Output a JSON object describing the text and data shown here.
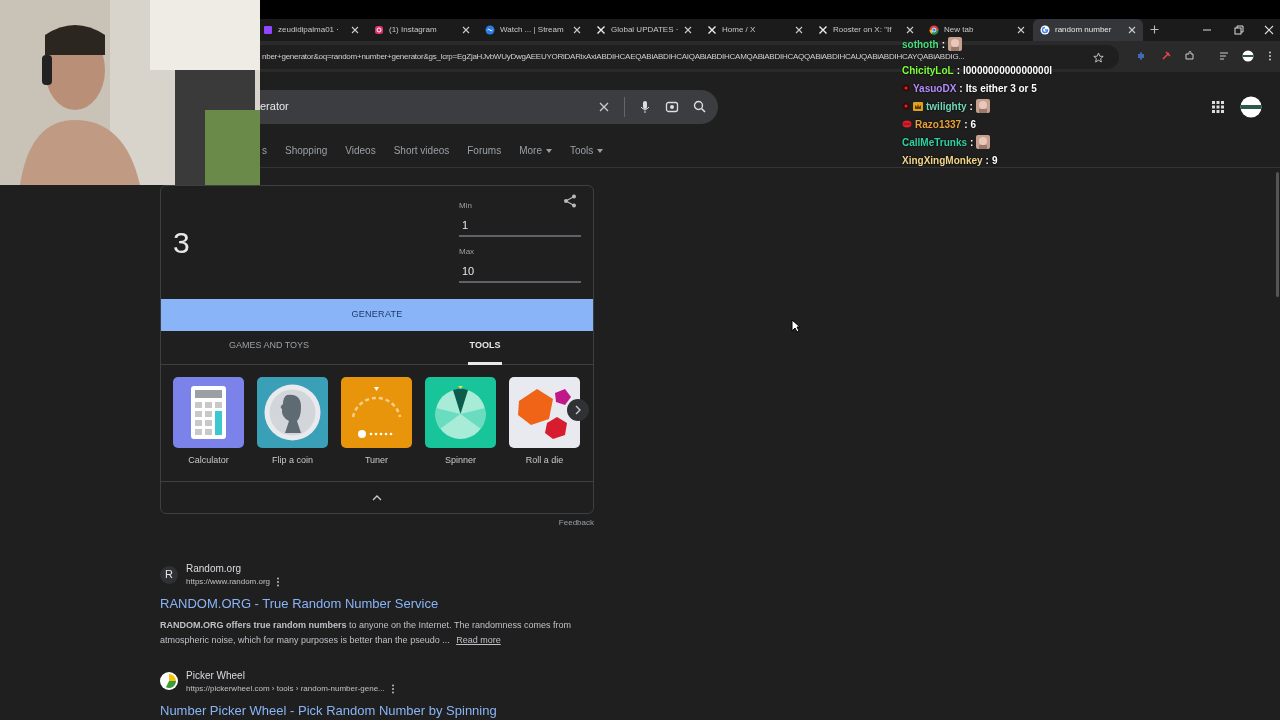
{
  "tabs": [
    {
      "title": "zeudidipalma01 ·",
      "kind": "twitch",
      "selected": false
    },
    {
      "title": "(1) Instagram",
      "kind": "instagram",
      "selected": false
    },
    {
      "title": "Watch ... | Stream",
      "kind": "stream",
      "selected": false
    },
    {
      "title": "Global UPDATES ·",
      "kind": "x",
      "selected": false
    },
    {
      "title": "Home / X",
      "kind": "x",
      "selected": false
    },
    {
      "title": "Rooster on X: \"If",
      "kind": "x",
      "selected": false
    },
    {
      "title": "New tab",
      "kind": "chrome",
      "selected": false
    },
    {
      "title": "random number",
      "kind": "google",
      "selected": true
    }
  ],
  "address_bar": {
    "url": "nber+generator&oq=random+number+generator&gs_lcrp=EgZjaHJvbWUyDwgAEEUYORiDARixAxiABDIHCAEQABiABDIHCAIQABiABDIHCAMQABiABDIHCAQQABiABDIHCAUQABiABDIHCAYQABiABDIG..."
  },
  "search": {
    "query": "erator"
  },
  "search_nav": [
    {
      "label": "s",
      "dropdown": false
    },
    {
      "label": "Shopping",
      "dropdown": false
    },
    {
      "label": "Videos",
      "dropdown": false
    },
    {
      "label": "Short videos",
      "dropdown": false
    },
    {
      "label": "Forums",
      "dropdown": false
    },
    {
      "label": "More",
      "dropdown": true
    },
    {
      "label": "Tools",
      "dropdown": true
    }
  ],
  "generator": {
    "result": "3",
    "min_label": "Min",
    "min": "1",
    "max_label": "Max",
    "max": "10",
    "button": "GENERATE",
    "tabs": [
      {
        "label": "GAMES AND TOYS",
        "selected": false
      },
      {
        "label": "TOOLS",
        "selected": true
      }
    ],
    "tools": [
      {
        "label": "Calculator",
        "kind": "calculator"
      },
      {
        "label": "Flip a coin",
        "kind": "coin"
      },
      {
        "label": "Tuner",
        "kind": "tuner"
      },
      {
        "label": "Spinner",
        "kind": "spinner"
      },
      {
        "label": "Roll a die",
        "kind": "die"
      }
    ],
    "feedback": "Feedback"
  },
  "results": [
    {
      "site": "Random.org",
      "favicon_letter": "R",
      "url": "https://www.random.org",
      "title": "RANDOM.ORG - True Random Number Service",
      "snippet": "**RANDOM.ORG offers true random numbers** to anyone on the Internet. The randomness comes from atmospheric noise, which for many purposes is better than the pseudo ...",
      "read_more": "Read more"
    },
    {
      "site": "Picker Wheel",
      "url": "https://pickerwheel.com › tools › random-number-gene...",
      "title": "Number Picker Wheel - Pick Random Number by Spinning"
    }
  ],
  "chat": [
    {
      "user": "sothoth",
      "color": "#4ade80",
      "separator": ":",
      "emote": true
    },
    {
      "user": "ChicityLoL",
      "color": "#7cfc3a",
      "separator": ":",
      "message": "l000000000000000l"
    },
    {
      "user": "YasuoDX",
      "color": "#b48cff",
      "badges": [
        {
          "kind": "dot"
        }
      ],
      "separator": ":",
      "message": "Its either 3 or 5"
    },
    {
      "user": "twilighty",
      "color": "#6fd6b8",
      "badges": [
        {
          "kind": "dot"
        },
        {
          "kind": "crown"
        }
      ],
      "separator": ":",
      "emote": true
    },
    {
      "user": "Razo1337",
      "color": "#e9a23b",
      "badges": [
        {
          "kind": "lips"
        }
      ],
      "separator": ":",
      "message": "6"
    },
    {
      "user": "CallMeTrunks",
      "color": "#2fd3a3",
      "separator": ":",
      "emote": true
    },
    {
      "user": "XingXingMonkey",
      "color": "#f2d58a",
      "separator": ":",
      "message": "9"
    }
  ]
}
